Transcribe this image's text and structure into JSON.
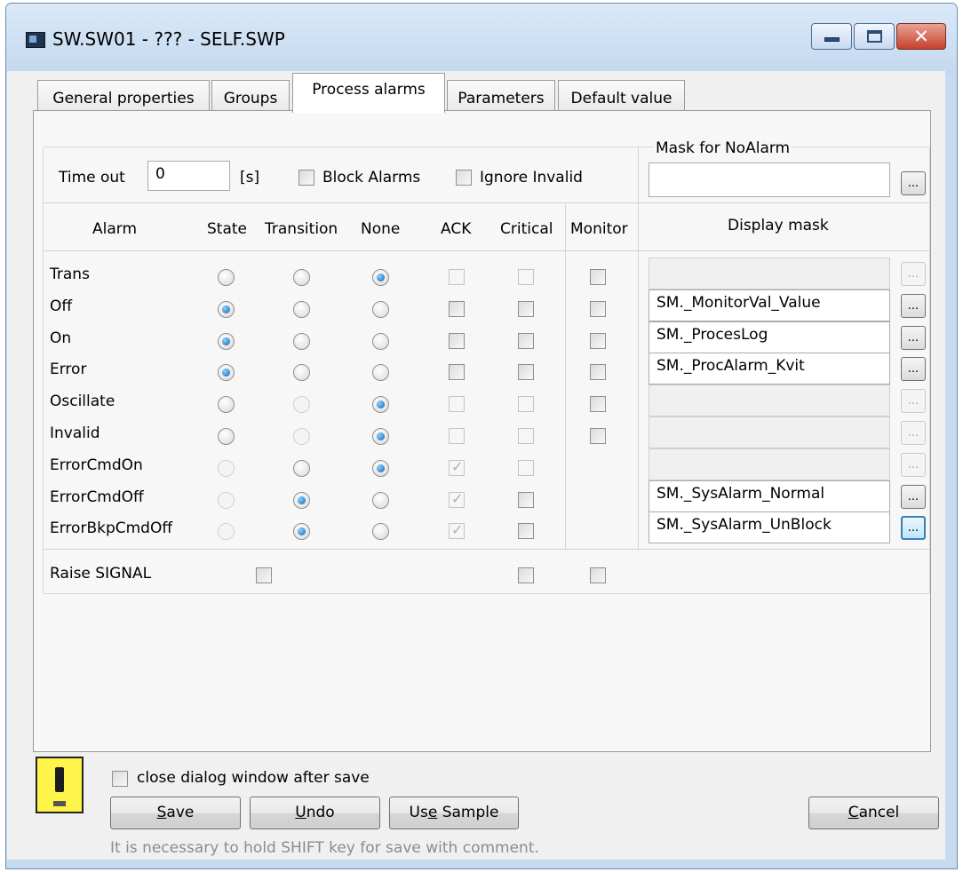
{
  "window": {
    "title": "SW.SW01 - ??? - SELF.SWP",
    "close_glyph": "✕"
  },
  "tabs": [
    {
      "label": "General properties"
    },
    {
      "label": "Groups"
    },
    {
      "label": "Process alarms",
      "active": true
    },
    {
      "label": "Parameters"
    },
    {
      "label": "Default value"
    }
  ],
  "timeout": {
    "label": "Time out",
    "value": "0",
    "unit": "[s]"
  },
  "block_alarms": {
    "label": "Block Alarms",
    "checked": false
  },
  "ignore_invalid": {
    "label": "Ignore Invalid",
    "checked": false
  },
  "mask_noalarm": {
    "label": "Mask for NoAlarm",
    "value": "",
    "button": "..."
  },
  "columns": {
    "alarm": "Alarm",
    "state": "State",
    "transition": "Transition",
    "none": "None",
    "ack": "ACK",
    "critical": "Critical",
    "monitor": "Monitor",
    "display_mask": "Display mask"
  },
  "rows": [
    {
      "name": "Trans",
      "mode": "none",
      "state_enabled": true,
      "trans_enabled": true,
      "ack_enabled": false,
      "ack": false,
      "crit_enabled": false,
      "crit": false,
      "monitor": true,
      "mask": "",
      "mask_enabled": false
    },
    {
      "name": "Off",
      "mode": "state",
      "state_enabled": true,
      "trans_enabled": true,
      "ack_enabled": true,
      "ack": false,
      "crit_enabled": true,
      "crit": false,
      "monitor": true,
      "mask": "SM._MonitorVal_Value",
      "mask_enabled": true
    },
    {
      "name": "On",
      "mode": "state",
      "state_enabled": true,
      "trans_enabled": true,
      "ack_enabled": true,
      "ack": false,
      "crit_enabled": true,
      "crit": false,
      "monitor": true,
      "mask": "SM._ProcesLog",
      "mask_enabled": true
    },
    {
      "name": "Error",
      "mode": "state",
      "state_enabled": true,
      "trans_enabled": true,
      "ack_enabled": true,
      "ack": false,
      "crit_enabled": true,
      "crit": false,
      "monitor": true,
      "mask": "SM._ProcAlarm_Kvit",
      "mask_enabled": true
    },
    {
      "name": "Oscillate",
      "mode": "none",
      "state_enabled": true,
      "trans_enabled": false,
      "ack_enabled": false,
      "ack": false,
      "crit_enabled": false,
      "crit": false,
      "monitor": true,
      "mask": "",
      "mask_enabled": false
    },
    {
      "name": "Invalid",
      "mode": "none",
      "state_enabled": true,
      "trans_enabled": false,
      "ack_enabled": false,
      "ack": false,
      "crit_enabled": false,
      "crit": false,
      "monitor": true,
      "mask": "",
      "mask_enabled": false
    },
    {
      "name": "ErrorCmdOn",
      "mode": "none",
      "state_enabled": false,
      "trans_enabled": true,
      "ack_enabled": false,
      "ack": true,
      "crit_enabled": false,
      "crit": false,
      "monitor": null,
      "mask": "",
      "mask_enabled": false
    },
    {
      "name": "ErrorCmdOff",
      "mode": "transition",
      "state_enabled": false,
      "trans_enabled": true,
      "ack_enabled": false,
      "ack": true,
      "crit_enabled": true,
      "crit": false,
      "monitor": null,
      "mask": "SM._SysAlarm_Normal",
      "mask_enabled": true
    },
    {
      "name": "ErrorBkpCmdOff",
      "mode": "transition",
      "state_enabled": false,
      "trans_enabled": true,
      "ack_enabled": false,
      "ack": true,
      "crit_enabled": true,
      "crit": false,
      "monitor": null,
      "mask": "SM._SysAlarm_UnBlock",
      "mask_enabled": true
    }
  ],
  "raise_signal": {
    "label": "Raise SIGNAL",
    "checked": false,
    "critical": false,
    "monitor": false
  },
  "footer": {
    "close_after_save": {
      "label": "close dialog window after save",
      "checked": false
    },
    "save": {
      "pre": "",
      "u": "S",
      "post": "ave"
    },
    "undo": {
      "pre": "",
      "u": "U",
      "post": "ndo"
    },
    "use_sample": {
      "pre": "Us",
      "u": "e",
      "post": " Sample"
    },
    "cancel": {
      "pre": "",
      "u": "C",
      "post": "ancel"
    },
    "hint": "It is necessary to hold SHIFT key for save with comment."
  },
  "colors": {
    "title_bar": "#c3d8ef",
    "close_button": "#c5402d",
    "dialog_bg": "#f0f0f0",
    "radio_checked": "#0f5fa8",
    "switch_icon": "#fff44a"
  },
  "icons": {
    "app": "window-app-icon",
    "switch": "switch-device-icon"
  }
}
